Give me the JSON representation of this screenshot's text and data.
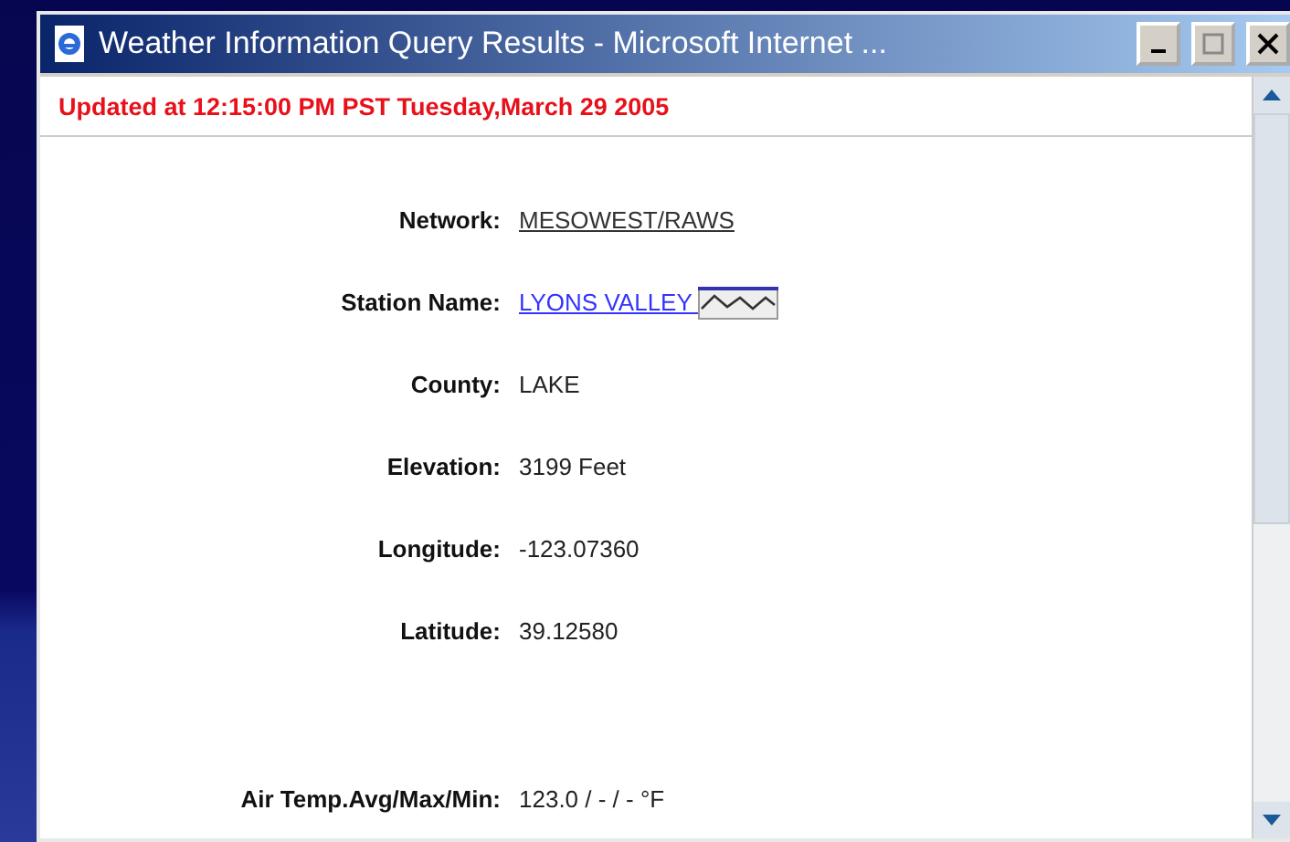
{
  "window": {
    "title": "Weather Information Query Results - Microsoft Internet ..."
  },
  "updated": "Updated at 12:15:00 PM PST Tuesday,March 29 2005",
  "fields": [
    {
      "label": "Network:",
      "value": "MESOWEST/RAWS",
      "kind": "underlined"
    },
    {
      "label": "Station Name:",
      "value": "LYONS VALLEY ",
      "kind": "link-chart"
    },
    {
      "label": "County:",
      "value": "LAKE",
      "kind": "plain"
    },
    {
      "label": "Elevation:",
      "value": "3199 Feet",
      "kind": "plain"
    },
    {
      "label": "Longitude:",
      "value": "-123.07360",
      "kind": "plain"
    },
    {
      "label": "Latitude:",
      "value": "39.12580",
      "kind": "plain"
    },
    {
      "label": "Air Temp.Avg/Max/Min:",
      "value": "123.0 / - / - °F",
      "kind": "plain",
      "gap_before": true
    }
  ]
}
